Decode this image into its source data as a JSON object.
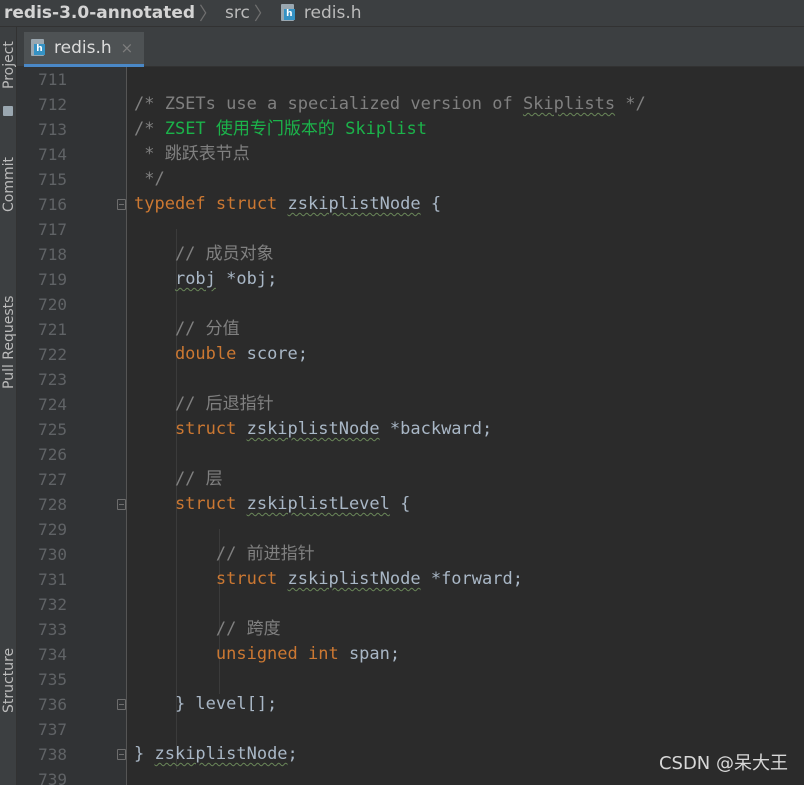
{
  "navbar": {
    "project": "redis-3.0-annotated",
    "folder": "src",
    "file": "redis.h",
    "file_icon": "c-header-file-icon"
  },
  "toolstrip": {
    "items": [
      "Project",
      "Commit",
      "Pull Requests",
      "Structure"
    ]
  },
  "tab": {
    "label": "redis.h",
    "close": "×",
    "icon": "c-header-file-icon"
  },
  "colors": {
    "background": "#2b2b2b",
    "keyword": "#cc7832",
    "comment": "#808080",
    "comment_highlight": "#1bb34a",
    "text": "#a9b7c6",
    "line_number": "#606366"
  },
  "lines": [
    {
      "no": "711",
      "parts": []
    },
    {
      "no": "712",
      "parts": [
        {
          "t": "/* ZSETs use a specialized version of ",
          "c": "cm"
        },
        {
          "t": "Skiplists",
          "c": "cm sq"
        },
        {
          "t": " */",
          "c": "cm"
        }
      ]
    },
    {
      "no": "713",
      "parts": [
        {
          "t": "/* ",
          "c": "cm"
        },
        {
          "t": "ZSET 使用专门版本的 Skiplist",
          "c": "cm-green"
        }
      ]
    },
    {
      "no": "714",
      "parts": [
        {
          "t": " * 跳跃表节点",
          "c": "cm"
        }
      ]
    },
    {
      "no": "715",
      "parts": [
        {
          "t": " */",
          "c": "cm"
        }
      ]
    },
    {
      "no": "716",
      "fold": true,
      "parts": [
        {
          "t": "typedef struct ",
          "c": "kw"
        },
        {
          "t": "zskiplistNode",
          "c": "sq"
        },
        {
          "t": " {",
          "c": ""
        }
      ]
    },
    {
      "no": "717",
      "parts": []
    },
    {
      "no": "718",
      "parts": [
        {
          "t": "    // 成员对象",
          "c": "cm"
        }
      ]
    },
    {
      "no": "719",
      "parts": [
        {
          "t": "    ",
          "c": ""
        },
        {
          "t": "robj",
          "c": "sq"
        },
        {
          "t": " *obj;",
          "c": ""
        }
      ]
    },
    {
      "no": "720",
      "parts": []
    },
    {
      "no": "721",
      "parts": [
        {
          "t": "    // 分值",
          "c": "cm"
        }
      ]
    },
    {
      "no": "722",
      "parts": [
        {
          "t": "    double",
          "c": "kw"
        },
        {
          "t": " score;",
          "c": ""
        }
      ]
    },
    {
      "no": "723",
      "parts": []
    },
    {
      "no": "724",
      "parts": [
        {
          "t": "    // 后退指针",
          "c": "cm"
        }
      ]
    },
    {
      "no": "725",
      "parts": [
        {
          "t": "    struct ",
          "c": "kw"
        },
        {
          "t": "zskiplistNode",
          "c": "sq"
        },
        {
          "t": " *backward;",
          "c": ""
        }
      ]
    },
    {
      "no": "726",
      "parts": []
    },
    {
      "no": "727",
      "parts": [
        {
          "t": "    // 层",
          "c": "cm"
        }
      ]
    },
    {
      "no": "728",
      "fold": true,
      "parts": [
        {
          "t": "    struct ",
          "c": "kw"
        },
        {
          "t": "zskiplistLevel",
          "c": "sq"
        },
        {
          "t": " {",
          "c": ""
        }
      ]
    },
    {
      "no": "729",
      "parts": []
    },
    {
      "no": "730",
      "parts": [
        {
          "t": "        // 前进指针",
          "c": "cm"
        }
      ]
    },
    {
      "no": "731",
      "parts": [
        {
          "t": "        struct ",
          "c": "kw"
        },
        {
          "t": "zskiplistNode",
          "c": "sq"
        },
        {
          "t": " *forward;",
          "c": ""
        }
      ]
    },
    {
      "no": "732",
      "parts": []
    },
    {
      "no": "733",
      "parts": [
        {
          "t": "        // 跨度",
          "c": "cm"
        }
      ]
    },
    {
      "no": "734",
      "parts": [
        {
          "t": "        unsigned int",
          "c": "kw"
        },
        {
          "t": " span;",
          "c": ""
        }
      ]
    },
    {
      "no": "735",
      "parts": []
    },
    {
      "no": "736",
      "fold": true,
      "parts": [
        {
          "t": "    } level[];",
          "c": ""
        }
      ]
    },
    {
      "no": "737",
      "parts": []
    },
    {
      "no": "738",
      "fold": true,
      "parts": [
        {
          "t": "} ",
          "c": ""
        },
        {
          "t": "zskiplistNode",
          "c": "sq"
        },
        {
          "t": ";",
          "c": ""
        }
      ]
    },
    {
      "no": "739",
      "parts": []
    }
  ],
  "watermark": "CSDN @呆大王"
}
